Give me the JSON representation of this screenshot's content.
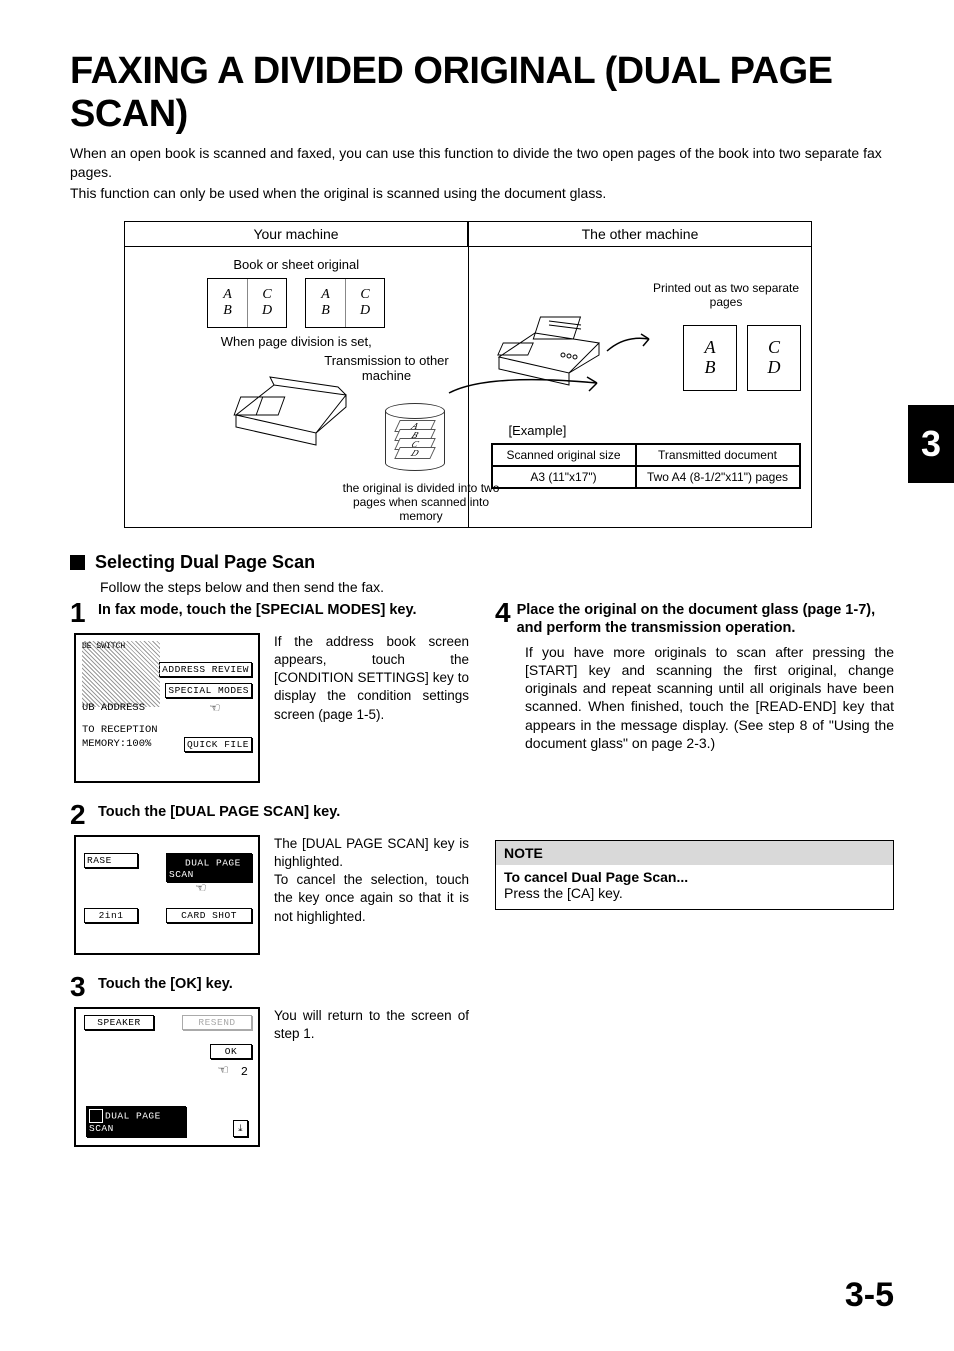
{
  "chapter_number": "3",
  "page_number": "3-5",
  "title": "FAXING A DIVIDED ORIGINAL  (DUAL PAGE SCAN)",
  "intro_p1": "When an open book is scanned and faxed, you can use this function to divide the two open pages of the book into two separate fax pages.",
  "intro_p2": "This function can only be used when the original is scanned using the document glass.",
  "diagram": {
    "head_left": "Your machine",
    "head_right": "The other machine",
    "sub_left_top": "Book or sheet original",
    "sub_left_mid": "When page division is set,",
    "trans_label": "Transmission to other machine",
    "db_caption": "the original is divided into two pages when scanned into memory",
    "book_letters": [
      "A",
      "B",
      "C",
      "D"
    ],
    "printed_caption": "Printed out as two separate pages",
    "example_label": "[Example]",
    "table": {
      "h1": "Scanned original size",
      "h2": "Transmitted document",
      "r1": "A3 (11\"x17\")",
      "r2": "Two A4 (8-1/2\"x11\") pages"
    }
  },
  "section_heading": "Selecting Dual Page Scan",
  "follow_text": "Follow the steps below and then send the fax.",
  "steps": {
    "s1": {
      "num": "1",
      "title": "In fax mode, touch the [SPECIAL MODES] key.",
      "text": "If the address book screen appears, touch the [CONDITION SETTINGS] key to display the condition settings screen (page 1-5).",
      "lcd": {
        "line0": "DE SWITCH",
        "btn1": "ADDRESS REVIEW",
        "btn2": "SPECIAL MODES",
        "line_sub": "UB ADDRESS",
        "line_to": "TO RECEPTION",
        "line_mem": "MEMORY:100%",
        "btn3": "QUICK FILE"
      }
    },
    "s2": {
      "num": "2",
      "title": "Touch the [DUAL PAGE SCAN] key.",
      "text1": "The [DUAL PAGE SCAN] key is highlighted.",
      "text2": "To cancel the selection, touch the key once again so that it is not highlighted.",
      "lcd": {
        "btn_left_top": "RASE",
        "btn_right_top": "DUAL PAGE SCAN",
        "btn_left_bot": "2in1",
        "btn_right_bot": "CARD SHOT"
      }
    },
    "s3": {
      "num": "3",
      "title": "Touch the [OK] key.",
      "text": "You will return to the screen of step 1.",
      "lcd": {
        "btn_speaker": "SPEAKER",
        "btn_resend": "RESEND",
        "btn_ok": "OK",
        "num": "2",
        "btn_dp": "DUAL PAGE SCAN"
      }
    },
    "s4": {
      "num": "4",
      "title": "Place the original on the document glass (page 1-7), and perform the transmission operation.",
      "text": "If you have more originals to scan after pressing the [START] key and scanning the first original, change originals and repeat scanning until all originals have been scanned. When finished, touch the [READ-END] key that appears in the message display. (See step 8 of \"Using the document glass\" on page 2-3.)"
    }
  },
  "note": {
    "head": "NOTE",
    "title": "To cancel Dual Page Scan...",
    "body": "Press the [CA] key."
  }
}
